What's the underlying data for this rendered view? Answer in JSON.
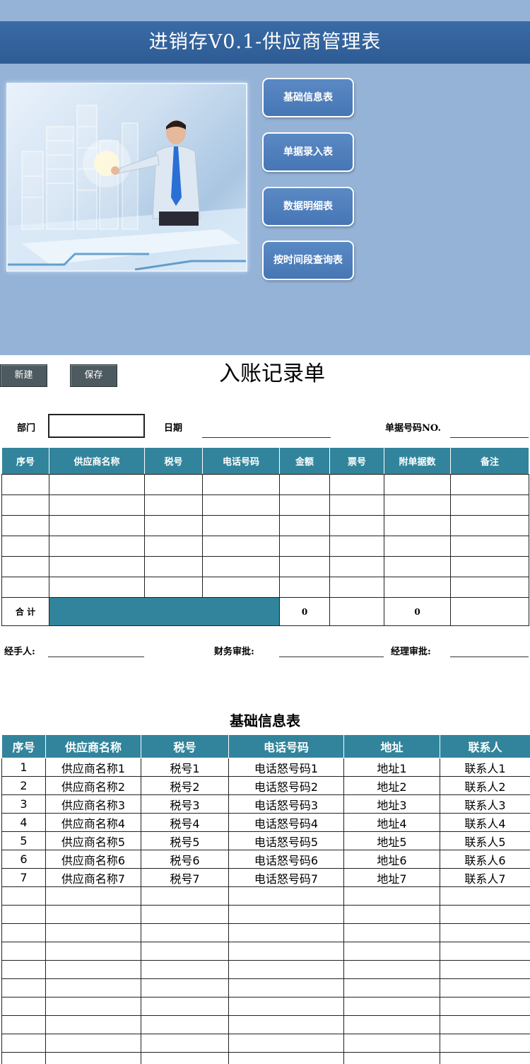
{
  "dashboard": {
    "title": "进销存V0.1-供应商管理表",
    "buttons": [
      "基础信息表",
      "单据录入表",
      "数据明细表",
      "按时间段查询表"
    ]
  },
  "form": {
    "new_label": "新建",
    "save_label": "保存",
    "title": "入账记录单",
    "dept_label": "部门",
    "date_label": "日期",
    "docno_label": "单据号码NO.",
    "columns": [
      "序号",
      "供应商名称",
      "税号",
      "电话号码",
      "金额",
      "票号",
      "附单据数",
      "备注"
    ],
    "empty_rows": 6,
    "total_label": "合 计",
    "total_amount": "0",
    "total_attachments": "0",
    "handler_label": "经手人:",
    "finance_label": "财务审批:",
    "manager_label": "经理审批:"
  },
  "info": {
    "title": "基础信息表",
    "columns": [
      "序号",
      "供应商名称",
      "税号",
      "电话号码",
      "地址",
      "联系人"
    ],
    "rows": [
      [
        "1",
        "供应商名称1",
        "税号1",
        "电话怒号码1",
        "地址1",
        "联系人1"
      ],
      [
        "2",
        "供应商名称2",
        "税号2",
        "电话怒号码2",
        "地址2",
        "联系人2"
      ],
      [
        "3",
        "供应商名称3",
        "税号3",
        "电话怒号码3",
        "地址3",
        "联系人3"
      ],
      [
        "4",
        "供应商名称4",
        "税号4",
        "电话怒号码4",
        "地址4",
        "联系人4"
      ],
      [
        "5",
        "供应商名称5",
        "税号5",
        "电话怒号码5",
        "地址5",
        "联系人5"
      ],
      [
        "6",
        "供应商名称6",
        "税号6",
        "电话怒号码6",
        "地址6",
        "联系人6"
      ],
      [
        "7",
        "供应商名称7",
        "税号7",
        "电话怒号码7",
        "地址7",
        "联系人7"
      ]
    ],
    "empty_rows": 10
  },
  "colors": {
    "dashboard_bg": "#95b3d7",
    "title_bar": "#2e5b94",
    "nav_button": "#4f7fbd",
    "table_header": "#31849b",
    "toolbar_button": "#4d5a5f"
  }
}
